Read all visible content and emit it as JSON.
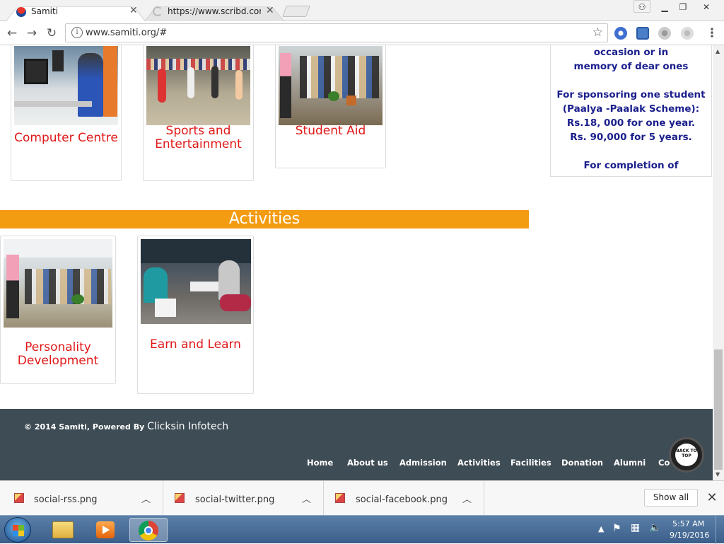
{
  "browser": {
    "tabs": [
      {
        "label": "Samiti",
        "active": true
      },
      {
        "label": "https://www.scribd.com/",
        "active": false
      }
    ],
    "url": "www.samiti.org/#"
  },
  "top_cards": [
    {
      "title": "Computer Centre"
    },
    {
      "title": "Sports and Entertainment"
    },
    {
      "title": "Student Aid"
    }
  ],
  "side_box": {
    "lines": [
      "occasion or in",
      "memory of dear ones",
      "",
      "For sponsoring one student",
      "(Paalya -Paalak Scheme):",
      "Rs.18, 000 for one year.",
      "Rs. 90,000 for 5 years.",
      "",
      "For completion of"
    ]
  },
  "activities": {
    "heading": "Activities",
    "cards": [
      {
        "title": "Personality Development"
      },
      {
        "title": "Earn and Learn"
      }
    ]
  },
  "footer": {
    "copyright": "© 2014 Samiti, Powered By",
    "brand": "Clicksin Infotech",
    "nav": [
      "Home",
      "About us",
      "Admission",
      "Activities",
      "Facilities",
      "Donation",
      "Alumni",
      "Co"
    ],
    "back_to_top": "BACK TO TOP"
  },
  "downloads": {
    "items": [
      "social-rss.png",
      "social-twitter.png",
      "social-facebook.png"
    ],
    "show_all": "Show all"
  },
  "taskbar": {
    "time": "5:57 AM",
    "date": "9/19/2016"
  }
}
